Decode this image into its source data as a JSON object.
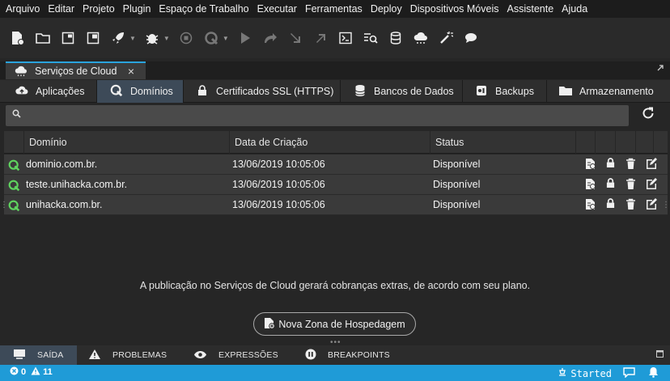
{
  "menu": [
    "Arquivo",
    "Editar",
    "Projeto",
    "Plugin",
    "Espaço de Trabalho",
    "Executar",
    "Ferramentas",
    "Deploy",
    "Dispositivos Móveis",
    "Assistente",
    "Ajuda"
  ],
  "toolbar": {
    "icons": [
      "new-file-icon",
      "open-folder-icon",
      "window-icon",
      "save-icon",
      "rocket-icon",
      "bug-icon",
      "stop-icon",
      "debug-run-icon",
      "play-icon",
      "step-over-icon",
      "step-into-icon",
      "step-out-icon",
      "terminal-icon",
      "search-list-icon",
      "database-icon",
      "cloud-icon",
      "magic-wand-icon",
      "chat-icon"
    ]
  },
  "doc_tab": {
    "label": "Serviços de Cloud"
  },
  "sub_tabs": [
    {
      "label": "Aplicações",
      "icon": "cloud-upload-icon"
    },
    {
      "label": "Domínios",
      "icon": "globe-icon"
    },
    {
      "label": "Certificados SSL (HTTPS)",
      "icon": "lock-icon"
    },
    {
      "label": "Bancos de Dados",
      "icon": "database-icon"
    },
    {
      "label": "Backups",
      "icon": "backup-icon"
    },
    {
      "label": "Armazenamento",
      "icon": "folder-icon"
    }
  ],
  "table": {
    "headers": [
      "Domínio",
      "Data de Criação",
      "Status"
    ],
    "rows": [
      {
        "domain": "dominio.com.br.",
        "created": "13/06/2019 10:05:06",
        "status": "Disponível"
      },
      {
        "domain": "teste.unihacka.com.br.",
        "created": "13/06/2019 10:05:06",
        "status": "Disponível"
      },
      {
        "domain": "unihacka.com.br.",
        "created": "13/06/2019 10:05:06",
        "status": "Disponível"
      }
    ]
  },
  "notice": "A publicação no Serviços de Cloud gerará cobranças extras, de acordo com seu plano.",
  "new_zone_label": "Nova Zona de Hospedagem",
  "bottom_tabs": [
    {
      "label": "SAÍDA",
      "icon": "monitor-icon"
    },
    {
      "label": "PROBLEMAS",
      "icon": "warning-icon"
    },
    {
      "label": "EXPRESSÕES",
      "icon": "eye-icon"
    },
    {
      "label": "BREAKPOINTS",
      "icon": "pause-icon"
    }
  ],
  "status_bar": {
    "errors": "0",
    "warnings": "11",
    "server_state": "Started"
  },
  "colors": {
    "accent": "#1f9bd7",
    "active_tab": "#3d4a58",
    "ok": "#5fd35f"
  }
}
